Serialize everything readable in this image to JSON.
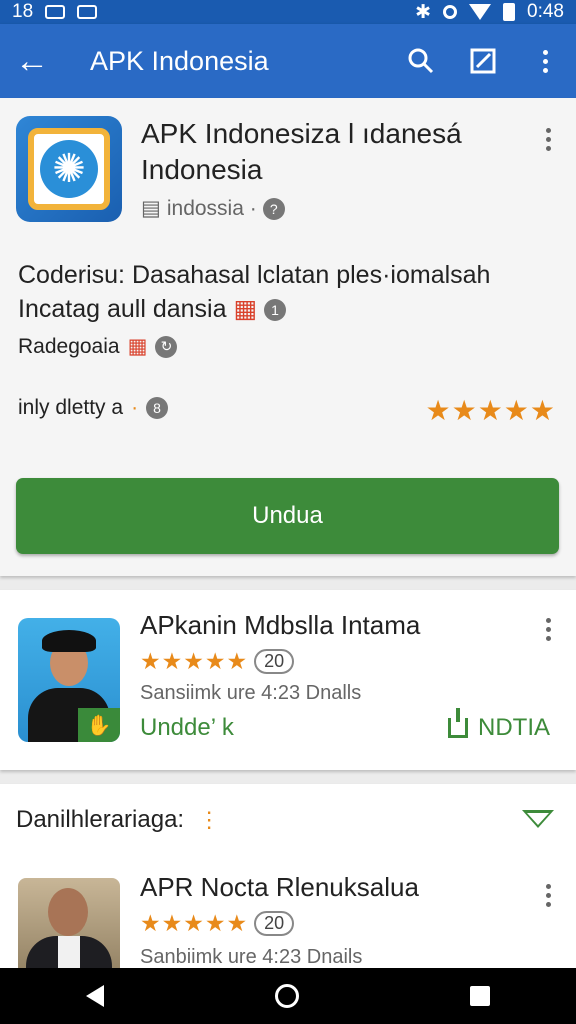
{
  "status_bar": {
    "left_text": "18",
    "time": "0:48"
  },
  "app_bar": {
    "title": "APK Indonesia"
  },
  "main_app": {
    "title": "APK Indonesiza l ıdanesá Indonesia",
    "developer": "indossia ·",
    "developer_badge": "?",
    "description": "Coderisu: Dasahasal lclatan ples·iomalsah Incatag aull dansia",
    "description_badge": "1",
    "sub_text": "Radegoaia",
    "meta_text": "inly dletty a",
    "meta_dot": "·",
    "meta_badge": "8",
    "stars": "★★★★★",
    "install_label": "Undua"
  },
  "recommended": {
    "title": "APkanin Mdbslla Intama",
    "stars": "★★★★★",
    "count": "20",
    "meta": "Sansiimk ure 4:23 Dnalls",
    "left_action": "Undde’ k",
    "right_action": "NDTIA"
  },
  "section": {
    "title": "Danilhlerariaga:",
    "dots": "⋮"
  },
  "section_item": {
    "title": "APR Nocta Rlenuksalua",
    "stars": "★★★★★",
    "count": "20",
    "meta": "Sanbiimk ure 4:23 Dnails"
  },
  "icons": {
    "back": "arrow-left-icon",
    "search": "search-icon",
    "edit": "edit-icon",
    "more": "more-vert-icon"
  },
  "colors": {
    "app_bar": "#2a6ac5",
    "status_bar": "#1a5bb0",
    "primary_green": "#3d8b3a",
    "star_orange": "#e88a1a"
  }
}
